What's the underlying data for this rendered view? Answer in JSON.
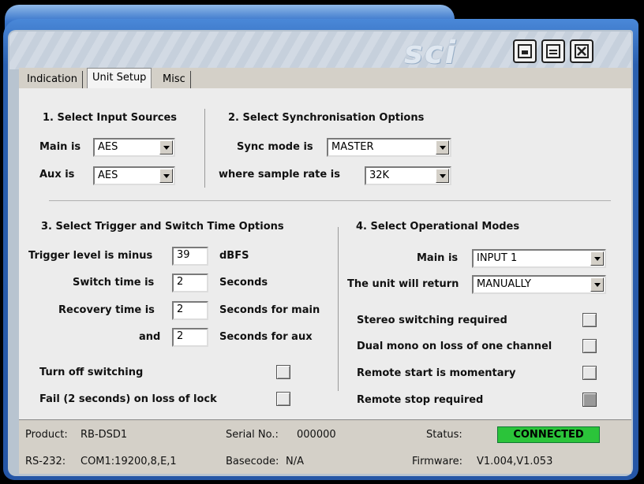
{
  "window": {
    "logo": "sci",
    "buttons": [
      "minimize",
      "maximize",
      "close"
    ]
  },
  "tabs": [
    "Indication",
    "Unit Setup",
    "Misc"
  ],
  "active_tab": "Unit Setup",
  "section1": {
    "heading": "1. Select Input Sources",
    "main_label": "Main is",
    "main_value": "AES",
    "aux_label": "Aux is",
    "aux_value": "AES"
  },
  "section2": {
    "heading": "2. Select Synchronisation Options",
    "sync_label": "Sync mode is",
    "sync_value": "MASTER",
    "rate_label": "where sample rate is",
    "rate_value": "32K"
  },
  "section3": {
    "heading": "3. Select Trigger and Switch Time Options",
    "trigger_label": "Trigger level is minus",
    "trigger_value": "39",
    "trigger_unit": "dBFS",
    "switch_label": "Switch time is",
    "switch_value": "2",
    "switch_unit": "Seconds",
    "recovery_label": "Recovery time is",
    "recovery_value": "2",
    "recovery_unit": "Seconds for main",
    "and_label": "and",
    "and_value": "2",
    "and_unit": "Seconds for aux",
    "turn_off_label": "Turn off switching",
    "fail_label": "Fail (2 seconds) on loss of lock"
  },
  "section4": {
    "heading": "4. Select Operational Modes",
    "main_label": "Main is",
    "main_value": "INPUT 1",
    "return_label": "The unit will return",
    "return_value": "MANUALLY",
    "stereo_label": "Stereo switching required",
    "dual_label": "Dual mono on loss of one channel",
    "remote_start_label": "Remote start is momentary",
    "remote_stop_label": "Remote stop required"
  },
  "status": {
    "product_label": "Product:",
    "product_value": "RB-DSD1",
    "serial_label": "Serial No.:",
    "serial_value": "000000",
    "status_label": "Status:",
    "status_value": "CONNECTED",
    "rs232_label": "RS-232:",
    "rs232_value": "COM1:19200,8,E,1",
    "basecode_label": "Basecode:",
    "basecode_value": "N/A",
    "firmware_label": "Firmware:",
    "firmware_value": "V1.004,V1.053"
  },
  "colors": {
    "frame": "#2a60b0",
    "panel": "#ececec",
    "status_ok": "#2bc43a"
  }
}
